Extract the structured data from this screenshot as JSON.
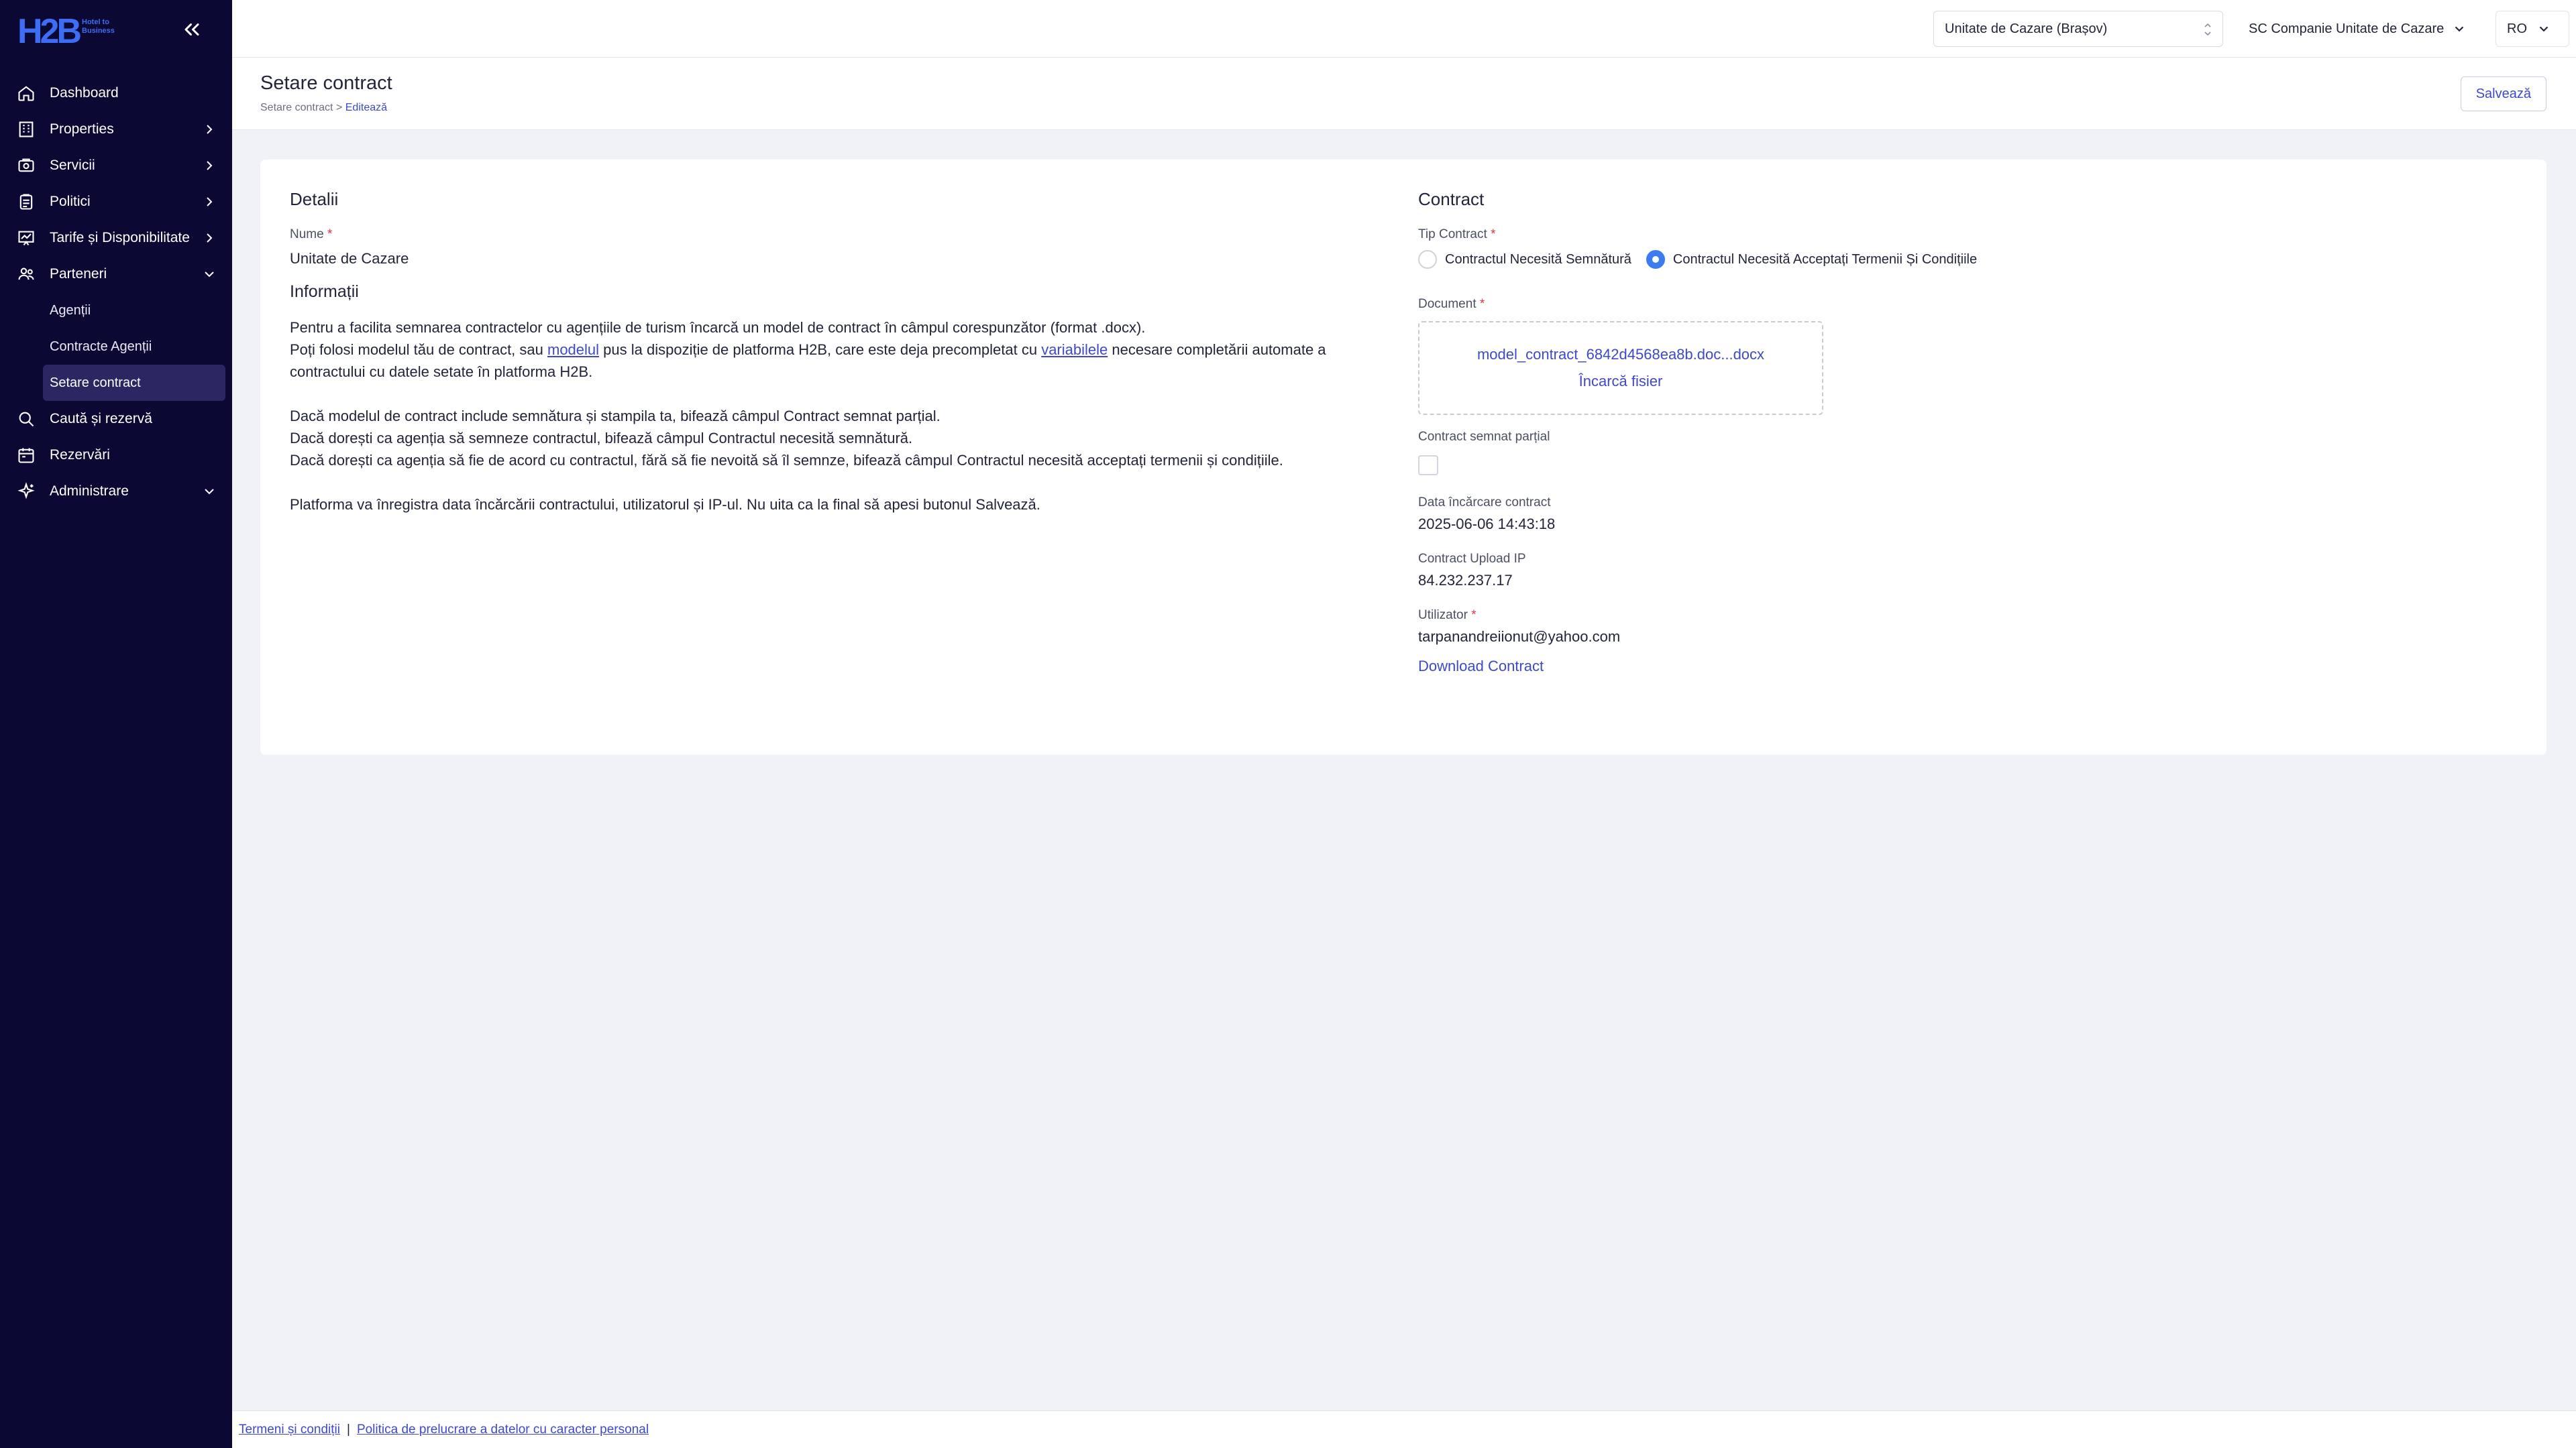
{
  "colors": {
    "sidebar_bg": "#0b0833",
    "accent": "#3d49c8",
    "radio_checked": "#3d7cf0",
    "required": "#e0334a",
    "page_bg": "#f0f2f7"
  },
  "logo": {
    "text": "H2B",
    "tagline_1": "Hotel to",
    "tagline_2": "Business",
    "icon": "h2b-logo"
  },
  "sidebar": {
    "collapse_icon": "double-chevron-left-icon",
    "items": [
      {
        "label": "Dashboard",
        "icon": "home-icon",
        "chevron": ""
      },
      {
        "label": "Properties",
        "icon": "building-icon",
        "chevron": "right"
      },
      {
        "label": "Servicii",
        "icon": "services-icon",
        "chevron": "right"
      },
      {
        "label": "Politici",
        "icon": "clipboard-icon",
        "chevron": "right"
      },
      {
        "label": "Tarife și Disponibilitate",
        "icon": "chart-icon",
        "chevron": "right"
      },
      {
        "label": "Parteneri",
        "icon": "users-icon",
        "chevron": "down"
      }
    ],
    "sub_items": [
      {
        "label": "Agenții"
      },
      {
        "label": "Contracte Agenții"
      },
      {
        "label": "Setare contract"
      }
    ],
    "items_after": [
      {
        "label": "Caută și rezervă",
        "icon": "search-icon",
        "chevron": ""
      },
      {
        "label": "Rezervări",
        "icon": "calendar-icon",
        "chevron": ""
      },
      {
        "label": "Administrare",
        "icon": "sparkle-icon",
        "chevron": "down"
      }
    ]
  },
  "topbar": {
    "property_select": "Unitate de Cazare (Brașov)",
    "company_select": "SC Companie Unitate de Cazare",
    "language": "RO"
  },
  "page": {
    "title": "Setare contract",
    "breadcrumb_root": "Setare contract",
    "breadcrumb_sep": ">",
    "breadcrumb_current": "Editează",
    "save_label": "Salvează"
  },
  "details": {
    "section_title": "Detalii",
    "name_label": "Nume",
    "required_mark": "*",
    "name_value": "Unitate de Cazare",
    "info_title": "Informații",
    "p1_line1": "Pentru a facilita semnarea contractelor cu agențiile de turism încarcă un model de contract în câmpul corespunzător (format .docx).",
    "p1_line2_a": "Poți folosi modelul tău de contract, sau ",
    "p1_link1": "modelul",
    "p1_line2_b": " pus la dispoziție de platforma H2B, care este deja precompletat cu ",
    "p1_link2": "variabilele",
    "p1_line2_c": " necesare completării automate a",
    "p1_line3": "contractului cu datele setate în platforma H2B.",
    "p2_line1": "Dacă modelul de contract include semnătura și stampila ta, bifează câmpul Contract semnat parțial.",
    "p2_line2": "Dacă dorești ca agenția să semneze contractul, bifează câmpul Contractul necesită semnătură.",
    "p2_line3": "Dacă dorești ca agenția să fie de acord cu contractul, fără să fie nevoită să îl semnze, bifează câmpul Contractul necesită acceptați termenii și condițiile.",
    "p3_line1": "Platforma va înregistra data încărcării contractului, utilizatorul și IP-ul. Nu uita ca la final să apesi butonul Salvează."
  },
  "contract": {
    "section_title": "Contract",
    "type_label": "Tip Contract",
    "radio_options": [
      {
        "label": "Contractul Necesită Semnătură",
        "checked": false
      },
      {
        "label": "Contractul Necesită Acceptați Termenii Și Condițiile",
        "checked": true
      }
    ],
    "document_label": "Document",
    "document_file": "model_contract_6842d4568ea8b.doc...docx",
    "upload_label": "Încarcă fisier",
    "partial_label": "Contract semnat parțial",
    "partial_checked": false,
    "upload_date_label": "Data încărcare contract",
    "upload_date_value": "2025-06-06 14:43:18",
    "ip_label": "Contract Upload IP",
    "ip_value": "84.232.237.17",
    "user_label": "Utilizator",
    "user_value": "tarpanandreiionut@yahoo.com",
    "download_label": "Download Contract"
  },
  "footer": {
    "terms": "Termeni și condiții",
    "separator": "|",
    "privacy": "Politica de prelucrare a datelor cu caracter personal"
  }
}
